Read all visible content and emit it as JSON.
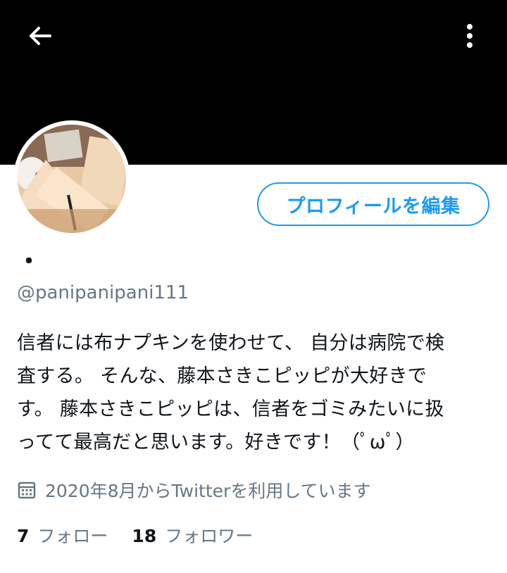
{
  "header": {
    "back_icon": "arrow-left-icon",
    "menu_icon": "more-vertical-icon",
    "banner_color": "#000000"
  },
  "profile": {
    "display_name": "・",
    "handle": "@panipanipani111",
    "edit_button_label": "プロフィールを編集",
    "bio": "信者には布ナプキンを使わせて、 自分は病院で検\n査する。 そんな、藤本さきこピッピが大好きで\nす。 藤本さきこピッピは、信者をゴミみたいに扱\nってて最高だと思います。好きです！（ﾟωﾟ）",
    "joined": "2020年8月からTwitterを利用しています",
    "joined_icon": "calendar-icon"
  },
  "stats": {
    "following_count": "7",
    "following_label": "フォロー",
    "followers_count": "18",
    "followers_label": "フォロワー"
  },
  "colors": {
    "accent": "#1d9bf0",
    "secondary_text": "#657786",
    "primary_text": "#0f1419"
  }
}
